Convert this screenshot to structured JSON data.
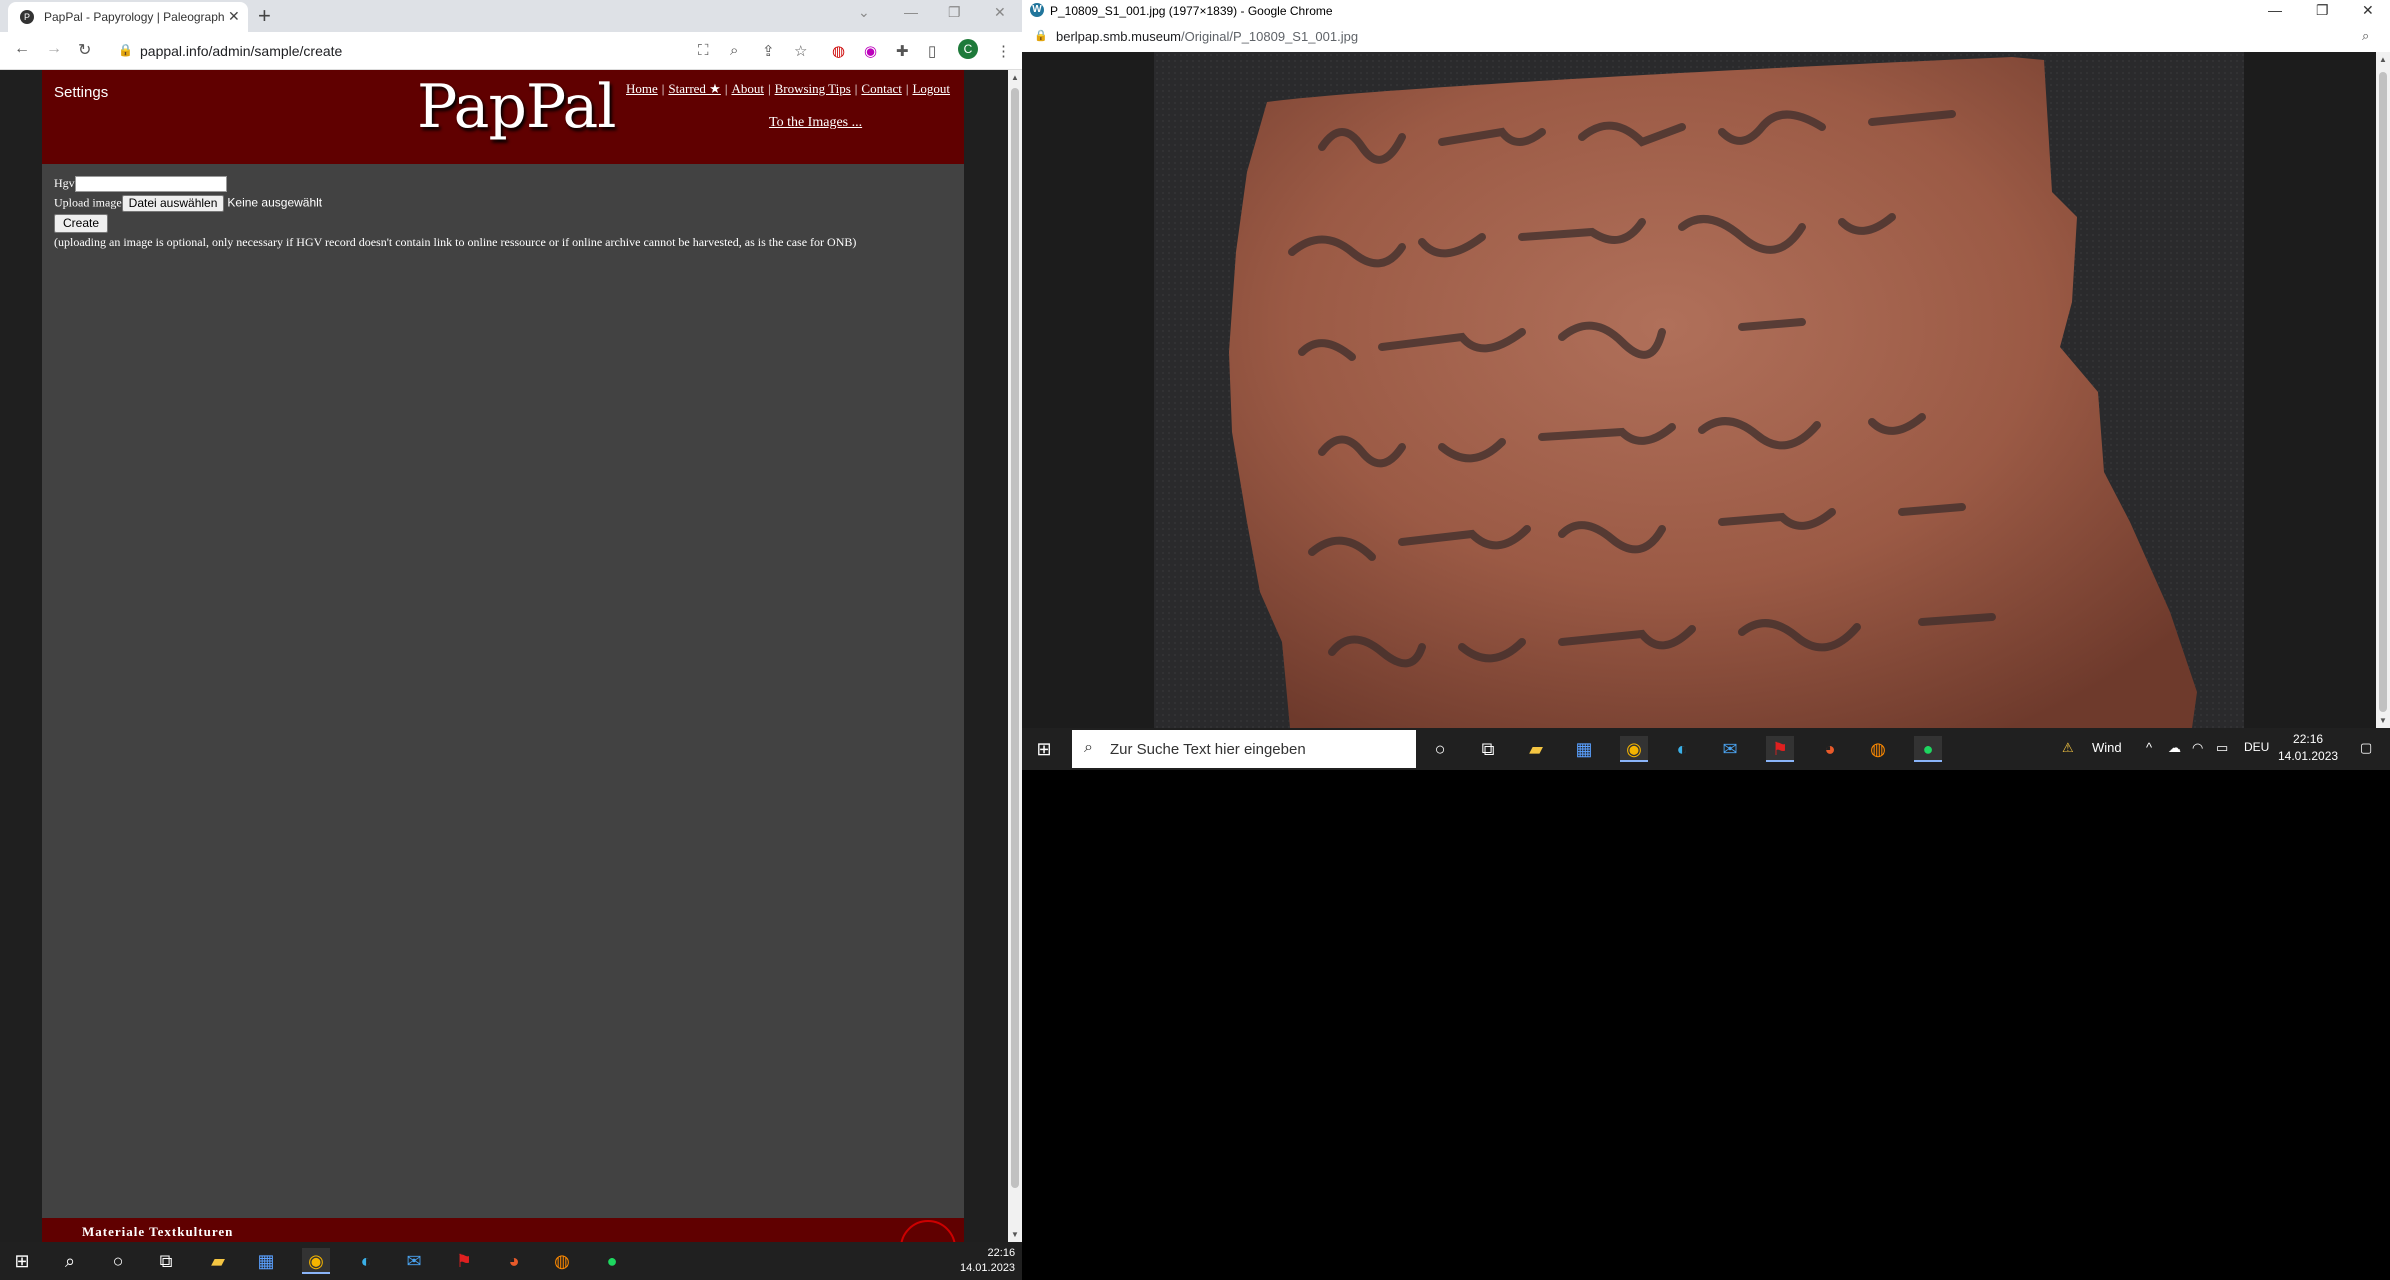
{
  "left_browser": {
    "tab_title": "PapPal - Papyrology | Paleograph",
    "url": "pappal.info/admin/sample/create",
    "profile_initial": "C"
  },
  "pappal": {
    "settings_label": "Settings",
    "logo": "PapPal",
    "nav": [
      "Home",
      "Starred ★",
      "About",
      "Browsing Tips",
      "Contact",
      "Logout"
    ],
    "to_images": "To the Images ...",
    "form": {
      "hgv_label": "Hgv",
      "hgv_value": "",
      "upload_label": "Upload image",
      "file_button": "Datei auswählen",
      "file_status": "Keine ausgewählt",
      "create_button": "Create",
      "note": "(uploading an image is optional, only necessary if HGV record doesn't contain link to online ressource or if online archive cannot be harvested, as is the case for ONB)"
    },
    "footer_text": "Materiale Textkulturen"
  },
  "left_taskbar": {
    "time": "22:16",
    "date": "14.01.2023"
  },
  "right_browser": {
    "window_title": "P_10809_S1_001.jpg (1977×1839) - Google Chrome",
    "url_domain": "berlpap.smb.museum",
    "url_path": "/Original/P_10809_S1_001.jpg"
  },
  "right_taskbar": {
    "search_placeholder": "Zur Suche Text hier eingeben",
    "weather": "Wind",
    "language": "DEU",
    "time": "22:16",
    "date": "14.01.2023"
  },
  "colors": {
    "pappal_header": "#600000",
    "pappal_body": "#424242",
    "page_background": "#1f1f1f",
    "taskbar": "#202020"
  }
}
